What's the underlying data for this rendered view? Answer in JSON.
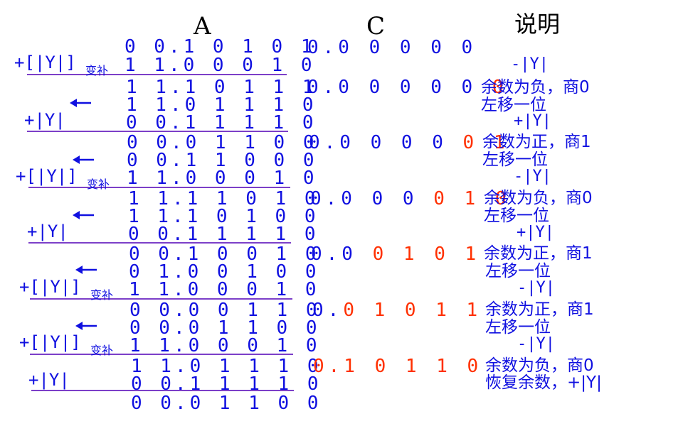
{
  "headers": {
    "a": "A",
    "c": "C",
    "note": "说明"
  },
  "colors": {
    "text": "#1010e0",
    "quotient": "#ff3000",
    "rule": "#7c3fc8",
    "header": "#000000"
  },
  "icons": [
    "left-arrow-icon"
  ],
  "ops": {
    "add_neg_y_comp": "+[|Y|]",
    "comp_subscript": "变补",
    "add_y": "+|Y|"
  },
  "a_rows": [
    "0 0.1 0 1 0 1",
    "1 1.0 0 0 1 0",
    "1 1.1 0 1 1 1",
    "1 1.0 1 1 1 0",
    "0 0.1 1 1 1 0",
    "0 0.0 1 1 0 0",
    "0 0.1 1 0 0 0",
    "1 1.0 0 0 1 0",
    "1 1.1 1 0 1 0",
    "1 1.1 0 1 0 0",
    "0 0.1 1 1 1 0",
    "0 0.1 0 0 1 0",
    "0 1.0 0 1 0 0",
    "1 1.0 0 0 1 0",
    "0 0.0 0 1 1 0",
    "0 0.0 1 1 0 0",
    "1 1.0 0 0 1 0",
    "1 1.0 1 1 1 0",
    "0 0.1 1 1 1 0",
    "0 0.0 1 1 0 0"
  ],
  "c_rows": [
    {
      "blue": "0.0 0 0 0 0",
      "red": ""
    },
    {
      "blue": "0.0 0 0 0 0",
      "red": "0"
    },
    {
      "blue": "0.0 0 0 0",
      "red": "0 1"
    },
    {
      "blue": "0.0 0 0",
      "red": "0 1 0"
    },
    {
      "blue": "0.0",
      "red": "0 1 0 1"
    },
    {
      "blue": "0.",
      "red": "0 1 0 1 1"
    },
    {
      "blue": "",
      "red": "0.1 0 1 1 0"
    }
  ],
  "notes": {
    "neg_y": "-|Y|",
    "pos_y": "+|Y|",
    "rem_neg_q0": "余数为负，商0",
    "rem_pos_q1": "余数为正，商1",
    "shift_left": "左移一位",
    "restore": "恢复余数，+|Y|"
  }
}
